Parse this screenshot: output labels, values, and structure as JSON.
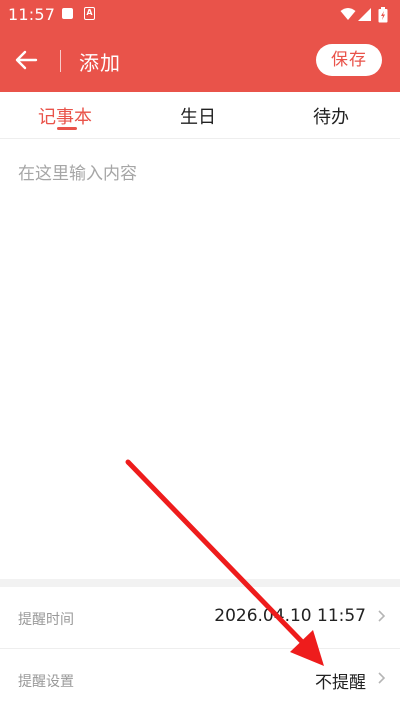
{
  "status_bar": {
    "time": "11:57",
    "icon_b_letter": "A"
  },
  "header": {
    "title": "添加",
    "save_label": "保存"
  },
  "tabs": [
    {
      "label": "记事本",
      "active": true
    },
    {
      "label": "生日",
      "active": false
    },
    {
      "label": "待办",
      "active": false
    }
  ],
  "editor": {
    "placeholder": "在这里输入内容",
    "value": ""
  },
  "settings": {
    "reminder_time_label": "提醒时间",
    "reminder_time_value": "2026.04.10 11:57",
    "reminder_setting_label": "提醒设置",
    "reminder_setting_value": "不提醒"
  },
  "colors": {
    "accent": "#e9534a",
    "annotation_arrow": "#ee1c1c"
  }
}
